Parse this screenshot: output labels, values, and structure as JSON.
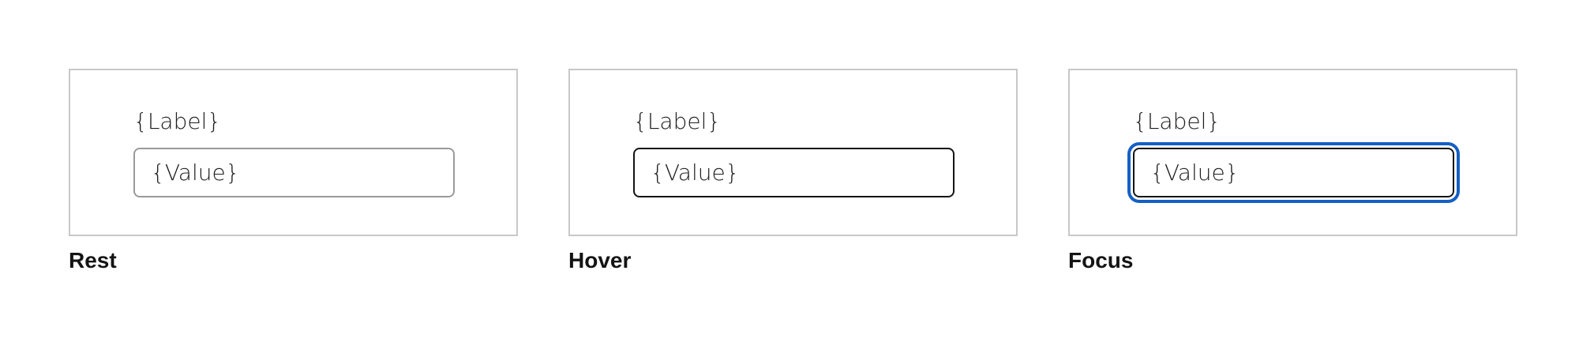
{
  "states": [
    {
      "caption": "Rest",
      "label": "{Label}",
      "value": "{Value}"
    },
    {
      "caption": "Hover",
      "label": "{Label}",
      "value": "{Value}"
    },
    {
      "caption": "Focus",
      "label": "{Label}",
      "value": "{Value}"
    }
  ],
  "colors": {
    "frame_border": "#c8c8c8",
    "rest_border": "#9a9a9a",
    "hover_border": "#141414",
    "focus_ring": "#1560c4"
  }
}
